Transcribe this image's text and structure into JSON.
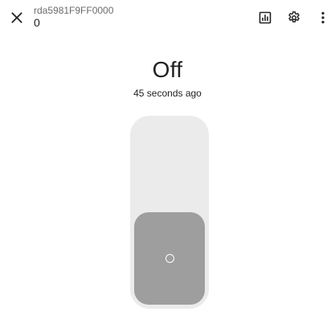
{
  "dialog": {
    "entity_id": "rda5981F9FF0000",
    "entity_name": "0"
  },
  "state": {
    "value": "Off",
    "last_changed": "45 seconds ago"
  },
  "toggle": {
    "is_on": false
  },
  "icons": {
    "close": "close-icon",
    "history": "chart-icon",
    "settings": "gear-icon",
    "more": "dots-vertical-icon",
    "toggle": "power-off-icon"
  },
  "colors": {
    "track": "#ebebeb",
    "thumb": "#9e9e9e",
    "icon": "#212121"
  }
}
